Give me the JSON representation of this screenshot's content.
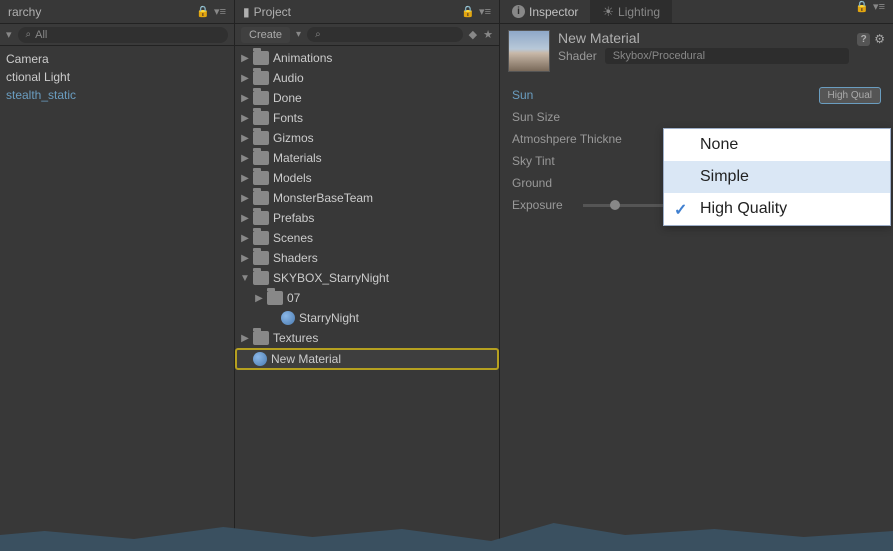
{
  "hierarchy": {
    "title": "rarchy",
    "search_placeholder": "All",
    "items": [
      {
        "label": "Camera",
        "inactive": false
      },
      {
        "label": "ctional Light",
        "inactive": false
      },
      {
        "label": "stealth_static",
        "inactive": true
      }
    ]
  },
  "project": {
    "title": "Project",
    "create_label": "Create",
    "tree": [
      {
        "label": "Animations",
        "type": "folder",
        "expanded": false,
        "indent": 0
      },
      {
        "label": "Audio",
        "type": "folder",
        "expanded": false,
        "indent": 0
      },
      {
        "label": "Done",
        "type": "folder",
        "expanded": false,
        "indent": 0
      },
      {
        "label": "Fonts",
        "type": "folder",
        "expanded": false,
        "indent": 0
      },
      {
        "label": "Gizmos",
        "type": "folder",
        "expanded": false,
        "indent": 0
      },
      {
        "label": "Materials",
        "type": "folder",
        "expanded": false,
        "indent": 0
      },
      {
        "label": "Models",
        "type": "folder",
        "expanded": false,
        "indent": 0
      },
      {
        "label": "MonsterBaseTeam",
        "type": "folder",
        "expanded": false,
        "indent": 0
      },
      {
        "label": "Prefabs",
        "type": "folder",
        "expanded": false,
        "indent": 0
      },
      {
        "label": "Scenes",
        "type": "folder",
        "expanded": false,
        "indent": 0
      },
      {
        "label": "Shaders",
        "type": "folder",
        "expanded": false,
        "indent": 0
      },
      {
        "label": "SKYBOX_StarryNight",
        "type": "folder",
        "expanded": true,
        "indent": 0
      },
      {
        "label": "07",
        "type": "folder",
        "expanded": false,
        "indent": 1
      },
      {
        "label": "StarryNight",
        "type": "material",
        "indent": 2
      },
      {
        "label": "Textures",
        "type": "folder",
        "expanded": false,
        "indent": 0
      },
      {
        "label": "New Material",
        "type": "material",
        "indent": 0,
        "selected": true
      }
    ]
  },
  "inspector": {
    "tab_inspector": "Inspector",
    "tab_lighting": "Lighting",
    "material_name": "New Material",
    "shader_label": "Shader",
    "shader_value": "Skybox/Procedural",
    "props": {
      "sun_label": "Sun",
      "sun_quality": "High Qual",
      "sun_size_label": "Sun Size",
      "atm_label": "Atmoshpere Thickne",
      "sky_tint_label": "Sky Tint",
      "ground_label": "Ground",
      "exposure_label": "Exposure",
      "exposure_value": "1"
    },
    "dropdown": {
      "none": "None",
      "simple": "Simple",
      "high_quality": "High Quality"
    }
  }
}
